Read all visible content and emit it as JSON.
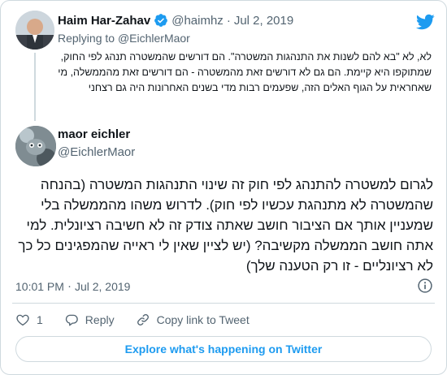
{
  "parent_tweet": {
    "name": "Haim Har-Zahav",
    "handle": "@haimhz",
    "separator": "·",
    "date": "Jul 2, 2019",
    "replying_prefix": "Replying to",
    "replying_to": "@EichlerMaor",
    "text": "לא, לא \"בא להם לשנות את התנהגות המשטרה\". הם דורשים שהמשטרה תנהג לפי החוק, שמתוקפו היא קיימת. הם גם לא דורשים זאת מהמשטרה - הם דורשים זאת מהממשלה, מי שאחראית על הגוף האלים הזה, שפעמים רבות מדי בשנים האחרונות היה גם רצחני",
    "verified_icon": "verified-badge-icon"
  },
  "main_tweet": {
    "name": "maor eichler",
    "handle": "@EichlerMaor",
    "text": "לגרום למשטרה להתנהג לפי חוק זה שינוי התנהגות המשטרה (בהנחה שהמשטרה לא מתנהגת עכשיו לפי חוק). לדרוש משהו מהממשלה בלי שמעניין אותך אם הציבור חושב שאתה צודק זה לא חשיבה רציונלית. למי אתה חושב הממשלה מקשיבה?  (יש לציין שאין לי ראייה שהמפגינים כל כך לא רציונליים - זו רק הטענה שלך)",
    "time": "10:01 PM",
    "separator": "·",
    "date": "Jul 2, 2019"
  },
  "actions": {
    "like_count": "1",
    "reply_label": "Reply",
    "copy_link_label": "Copy link to Tweet"
  },
  "explore_label": "Explore what's happening on Twitter",
  "colors": {
    "accent": "#1d9bf0",
    "muted": "#536471",
    "border": "#cfd9de"
  },
  "icons": [
    "twitter-bird-icon",
    "verified-badge-icon",
    "info-icon",
    "heart-icon",
    "reply-icon",
    "link-icon"
  ]
}
